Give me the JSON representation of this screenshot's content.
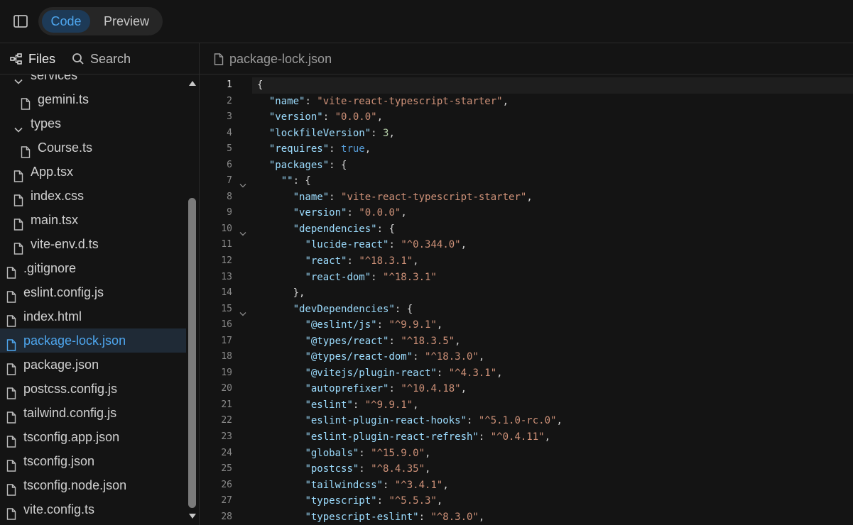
{
  "toolbar": {
    "code_label": "Code",
    "preview_label": "Preview"
  },
  "files_panel": {
    "files_label": "Files",
    "search_label": "Search"
  },
  "tree": [
    {
      "label": "services",
      "type": "folder",
      "depth": 1
    },
    {
      "label": "gemini.ts",
      "type": "file",
      "depth": 2
    },
    {
      "label": "types",
      "type": "folder",
      "depth": 1
    },
    {
      "label": "Course.ts",
      "type": "file",
      "depth": 2
    },
    {
      "label": "App.tsx",
      "type": "file",
      "depth": 1
    },
    {
      "label": "index.css",
      "type": "file",
      "depth": 1
    },
    {
      "label": "main.tsx",
      "type": "file",
      "depth": 1
    },
    {
      "label": "vite-env.d.ts",
      "type": "file",
      "depth": 1
    },
    {
      "label": ".gitignore",
      "type": "file",
      "depth": 0
    },
    {
      "label": "eslint.config.js",
      "type": "file",
      "depth": 0
    },
    {
      "label": "index.html",
      "type": "file",
      "depth": 0
    },
    {
      "label": "package-lock.json",
      "type": "file",
      "depth": 0,
      "selected": true
    },
    {
      "label": "package.json",
      "type": "file",
      "depth": 0
    },
    {
      "label": "postcss.config.js",
      "type": "file",
      "depth": 0
    },
    {
      "label": "tailwind.config.js",
      "type": "file",
      "depth": 0
    },
    {
      "label": "tsconfig.app.json",
      "type": "file",
      "depth": 0
    },
    {
      "label": "tsconfig.json",
      "type": "file",
      "depth": 0
    },
    {
      "label": "tsconfig.node.json",
      "type": "file",
      "depth": 0
    },
    {
      "label": "vite.config.ts",
      "type": "file",
      "depth": 0
    }
  ],
  "editor": {
    "tab_name": "package-lock.json",
    "active_line": 1,
    "lines": [
      {
        "n": 1,
        "indent": 0,
        "fold": false,
        "tokens": [
          [
            "p",
            "{"
          ]
        ]
      },
      {
        "n": 2,
        "indent": 1,
        "fold": false,
        "tokens": [
          [
            "k",
            "\"name\""
          ],
          [
            "p",
            ": "
          ],
          [
            "s",
            "\"vite-react-typescript-starter\""
          ],
          [
            "p",
            ","
          ]
        ]
      },
      {
        "n": 3,
        "indent": 1,
        "fold": false,
        "tokens": [
          [
            "k",
            "\"version\""
          ],
          [
            "p",
            ": "
          ],
          [
            "s",
            "\"0.0.0\""
          ],
          [
            "p",
            ","
          ]
        ]
      },
      {
        "n": 4,
        "indent": 1,
        "fold": false,
        "tokens": [
          [
            "k",
            "\"lockfileVersion\""
          ],
          [
            "p",
            ": "
          ],
          [
            "n",
            "3"
          ],
          [
            "p",
            ","
          ]
        ]
      },
      {
        "n": 5,
        "indent": 1,
        "fold": false,
        "tokens": [
          [
            "k",
            "\"requires\""
          ],
          [
            "p",
            ": "
          ],
          [
            "b",
            "true"
          ],
          [
            "p",
            ","
          ]
        ]
      },
      {
        "n": 6,
        "indent": 1,
        "fold": false,
        "tokens": [
          [
            "k",
            "\"packages\""
          ],
          [
            "p",
            ": {"
          ]
        ]
      },
      {
        "n": 7,
        "indent": 2,
        "fold": true,
        "tokens": [
          [
            "k",
            "\"\""
          ],
          [
            "p",
            ": {"
          ]
        ]
      },
      {
        "n": 8,
        "indent": 3,
        "fold": false,
        "tokens": [
          [
            "k",
            "\"name\""
          ],
          [
            "p",
            ": "
          ],
          [
            "s",
            "\"vite-react-typescript-starter\""
          ],
          [
            "p",
            ","
          ]
        ]
      },
      {
        "n": 9,
        "indent": 3,
        "fold": false,
        "tokens": [
          [
            "k",
            "\"version\""
          ],
          [
            "p",
            ": "
          ],
          [
            "s",
            "\"0.0.0\""
          ],
          [
            "p",
            ","
          ]
        ]
      },
      {
        "n": 10,
        "indent": 3,
        "fold": true,
        "tokens": [
          [
            "k",
            "\"dependencies\""
          ],
          [
            "p",
            ": {"
          ]
        ]
      },
      {
        "n": 11,
        "indent": 4,
        "fold": false,
        "tokens": [
          [
            "k",
            "\"lucide-react\""
          ],
          [
            "p",
            ": "
          ],
          [
            "s",
            "\"^0.344.0\""
          ],
          [
            "p",
            ","
          ]
        ]
      },
      {
        "n": 12,
        "indent": 4,
        "fold": false,
        "tokens": [
          [
            "k",
            "\"react\""
          ],
          [
            "p",
            ": "
          ],
          [
            "s",
            "\"^18.3.1\""
          ],
          [
            "p",
            ","
          ]
        ]
      },
      {
        "n": 13,
        "indent": 4,
        "fold": false,
        "tokens": [
          [
            "k",
            "\"react-dom\""
          ],
          [
            "p",
            ": "
          ],
          [
            "s",
            "\"^18.3.1\""
          ]
        ]
      },
      {
        "n": 14,
        "indent": 3,
        "fold": false,
        "tokens": [
          [
            "p",
            "},"
          ]
        ]
      },
      {
        "n": 15,
        "indent": 3,
        "fold": true,
        "tokens": [
          [
            "k",
            "\"devDependencies\""
          ],
          [
            "p",
            ": {"
          ]
        ]
      },
      {
        "n": 16,
        "indent": 4,
        "fold": false,
        "tokens": [
          [
            "k",
            "\"@eslint/js\""
          ],
          [
            "p",
            ": "
          ],
          [
            "s",
            "\"^9.9.1\""
          ],
          [
            "p",
            ","
          ]
        ]
      },
      {
        "n": 17,
        "indent": 4,
        "fold": false,
        "tokens": [
          [
            "k",
            "\"@types/react\""
          ],
          [
            "p",
            ": "
          ],
          [
            "s",
            "\"^18.3.5\""
          ],
          [
            "p",
            ","
          ]
        ]
      },
      {
        "n": 18,
        "indent": 4,
        "fold": false,
        "tokens": [
          [
            "k",
            "\"@types/react-dom\""
          ],
          [
            "p",
            ": "
          ],
          [
            "s",
            "\"^18.3.0\""
          ],
          [
            "p",
            ","
          ]
        ]
      },
      {
        "n": 19,
        "indent": 4,
        "fold": false,
        "tokens": [
          [
            "k",
            "\"@vitejs/plugin-react\""
          ],
          [
            "p",
            ": "
          ],
          [
            "s",
            "\"^4.3.1\""
          ],
          [
            "p",
            ","
          ]
        ]
      },
      {
        "n": 20,
        "indent": 4,
        "fold": false,
        "tokens": [
          [
            "k",
            "\"autoprefixer\""
          ],
          [
            "p",
            ": "
          ],
          [
            "s",
            "\"^10.4.18\""
          ],
          [
            "p",
            ","
          ]
        ]
      },
      {
        "n": 21,
        "indent": 4,
        "fold": false,
        "tokens": [
          [
            "k",
            "\"eslint\""
          ],
          [
            "p",
            ": "
          ],
          [
            "s",
            "\"^9.9.1\""
          ],
          [
            "p",
            ","
          ]
        ]
      },
      {
        "n": 22,
        "indent": 4,
        "fold": false,
        "tokens": [
          [
            "k",
            "\"eslint-plugin-react-hooks\""
          ],
          [
            "p",
            ": "
          ],
          [
            "s",
            "\"^5.1.0-rc.0\""
          ],
          [
            "p",
            ","
          ]
        ]
      },
      {
        "n": 23,
        "indent": 4,
        "fold": false,
        "tokens": [
          [
            "k",
            "\"eslint-plugin-react-refresh\""
          ],
          [
            "p",
            ": "
          ],
          [
            "s",
            "\"^0.4.11\""
          ],
          [
            "p",
            ","
          ]
        ]
      },
      {
        "n": 24,
        "indent": 4,
        "fold": false,
        "tokens": [
          [
            "k",
            "\"globals\""
          ],
          [
            "p",
            ": "
          ],
          [
            "s",
            "\"^15.9.0\""
          ],
          [
            "p",
            ","
          ]
        ]
      },
      {
        "n": 25,
        "indent": 4,
        "fold": false,
        "tokens": [
          [
            "k",
            "\"postcss\""
          ],
          [
            "p",
            ": "
          ],
          [
            "s",
            "\"^8.4.35\""
          ],
          [
            "p",
            ","
          ]
        ]
      },
      {
        "n": 26,
        "indent": 4,
        "fold": false,
        "tokens": [
          [
            "k",
            "\"tailwindcss\""
          ],
          [
            "p",
            ": "
          ],
          [
            "s",
            "\"^3.4.1\""
          ],
          [
            "p",
            ","
          ]
        ]
      },
      {
        "n": 27,
        "indent": 4,
        "fold": false,
        "tokens": [
          [
            "k",
            "\"typescript\""
          ],
          [
            "p",
            ": "
          ],
          [
            "s",
            "\"^5.5.3\""
          ],
          [
            "p",
            ","
          ]
        ]
      },
      {
        "n": 28,
        "indent": 4,
        "fold": false,
        "tokens": [
          [
            "k",
            "\"typescript-eslint\""
          ],
          [
            "p",
            ": "
          ],
          [
            "s",
            "\"^8.3.0\""
          ],
          [
            "p",
            ","
          ]
        ]
      }
    ]
  },
  "colors": {
    "accent": "#4ea6ee",
    "background": "#141414",
    "json_key": "#9cdcfe",
    "json_string": "#ce9178",
    "json_number": "#b5cea8",
    "json_boolean": "#569cd6"
  }
}
